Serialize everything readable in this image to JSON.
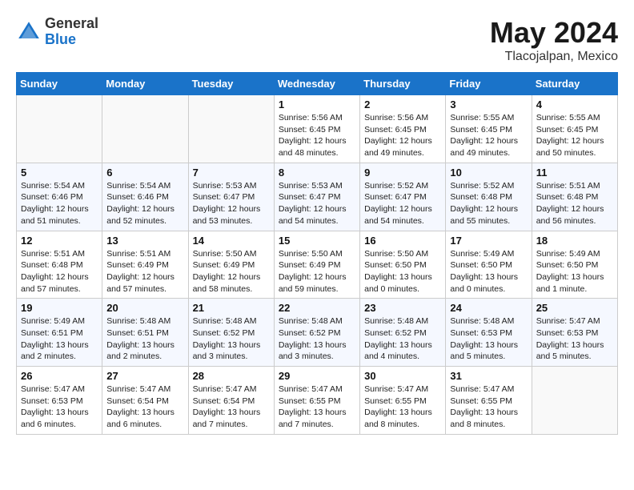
{
  "header": {
    "logo_general": "General",
    "logo_blue": "Blue",
    "title": "May 2024",
    "location": "Tlacojalpan, Mexico"
  },
  "weekdays": [
    "Sunday",
    "Monday",
    "Tuesday",
    "Wednesday",
    "Thursday",
    "Friday",
    "Saturday"
  ],
  "weeks": [
    [
      {
        "day": "",
        "info": ""
      },
      {
        "day": "",
        "info": ""
      },
      {
        "day": "",
        "info": ""
      },
      {
        "day": "1",
        "info": "Sunrise: 5:56 AM\nSunset: 6:45 PM\nDaylight: 12 hours\nand 48 minutes."
      },
      {
        "day": "2",
        "info": "Sunrise: 5:56 AM\nSunset: 6:45 PM\nDaylight: 12 hours\nand 49 minutes."
      },
      {
        "day": "3",
        "info": "Sunrise: 5:55 AM\nSunset: 6:45 PM\nDaylight: 12 hours\nand 49 minutes."
      },
      {
        "day": "4",
        "info": "Sunrise: 5:55 AM\nSunset: 6:45 PM\nDaylight: 12 hours\nand 50 minutes."
      }
    ],
    [
      {
        "day": "5",
        "info": "Sunrise: 5:54 AM\nSunset: 6:46 PM\nDaylight: 12 hours\nand 51 minutes."
      },
      {
        "day": "6",
        "info": "Sunrise: 5:54 AM\nSunset: 6:46 PM\nDaylight: 12 hours\nand 52 minutes."
      },
      {
        "day": "7",
        "info": "Sunrise: 5:53 AM\nSunset: 6:47 PM\nDaylight: 12 hours\nand 53 minutes."
      },
      {
        "day": "8",
        "info": "Sunrise: 5:53 AM\nSunset: 6:47 PM\nDaylight: 12 hours\nand 54 minutes."
      },
      {
        "day": "9",
        "info": "Sunrise: 5:52 AM\nSunset: 6:47 PM\nDaylight: 12 hours\nand 54 minutes."
      },
      {
        "day": "10",
        "info": "Sunrise: 5:52 AM\nSunset: 6:48 PM\nDaylight: 12 hours\nand 55 minutes."
      },
      {
        "day": "11",
        "info": "Sunrise: 5:51 AM\nSunset: 6:48 PM\nDaylight: 12 hours\nand 56 minutes."
      }
    ],
    [
      {
        "day": "12",
        "info": "Sunrise: 5:51 AM\nSunset: 6:48 PM\nDaylight: 12 hours\nand 57 minutes."
      },
      {
        "day": "13",
        "info": "Sunrise: 5:51 AM\nSunset: 6:49 PM\nDaylight: 12 hours\nand 57 minutes."
      },
      {
        "day": "14",
        "info": "Sunrise: 5:50 AM\nSunset: 6:49 PM\nDaylight: 12 hours\nand 58 minutes."
      },
      {
        "day": "15",
        "info": "Sunrise: 5:50 AM\nSunset: 6:49 PM\nDaylight: 12 hours\nand 59 minutes."
      },
      {
        "day": "16",
        "info": "Sunrise: 5:50 AM\nSunset: 6:50 PM\nDaylight: 13 hours\nand 0 minutes."
      },
      {
        "day": "17",
        "info": "Sunrise: 5:49 AM\nSunset: 6:50 PM\nDaylight: 13 hours\nand 0 minutes."
      },
      {
        "day": "18",
        "info": "Sunrise: 5:49 AM\nSunset: 6:50 PM\nDaylight: 13 hours\nand 1 minute."
      }
    ],
    [
      {
        "day": "19",
        "info": "Sunrise: 5:49 AM\nSunset: 6:51 PM\nDaylight: 13 hours\nand 2 minutes."
      },
      {
        "day": "20",
        "info": "Sunrise: 5:48 AM\nSunset: 6:51 PM\nDaylight: 13 hours\nand 2 minutes."
      },
      {
        "day": "21",
        "info": "Sunrise: 5:48 AM\nSunset: 6:52 PM\nDaylight: 13 hours\nand 3 minutes."
      },
      {
        "day": "22",
        "info": "Sunrise: 5:48 AM\nSunset: 6:52 PM\nDaylight: 13 hours\nand 3 minutes."
      },
      {
        "day": "23",
        "info": "Sunrise: 5:48 AM\nSunset: 6:52 PM\nDaylight: 13 hours\nand 4 minutes."
      },
      {
        "day": "24",
        "info": "Sunrise: 5:48 AM\nSunset: 6:53 PM\nDaylight: 13 hours\nand 5 minutes."
      },
      {
        "day": "25",
        "info": "Sunrise: 5:47 AM\nSunset: 6:53 PM\nDaylight: 13 hours\nand 5 minutes."
      }
    ],
    [
      {
        "day": "26",
        "info": "Sunrise: 5:47 AM\nSunset: 6:53 PM\nDaylight: 13 hours\nand 6 minutes."
      },
      {
        "day": "27",
        "info": "Sunrise: 5:47 AM\nSunset: 6:54 PM\nDaylight: 13 hours\nand 6 minutes."
      },
      {
        "day": "28",
        "info": "Sunrise: 5:47 AM\nSunset: 6:54 PM\nDaylight: 13 hours\nand 7 minutes."
      },
      {
        "day": "29",
        "info": "Sunrise: 5:47 AM\nSunset: 6:55 PM\nDaylight: 13 hours\nand 7 minutes."
      },
      {
        "day": "30",
        "info": "Sunrise: 5:47 AM\nSunset: 6:55 PM\nDaylight: 13 hours\nand 8 minutes."
      },
      {
        "day": "31",
        "info": "Sunrise: 5:47 AM\nSunset: 6:55 PM\nDaylight: 13 hours\nand 8 minutes."
      },
      {
        "day": "",
        "info": ""
      }
    ]
  ]
}
